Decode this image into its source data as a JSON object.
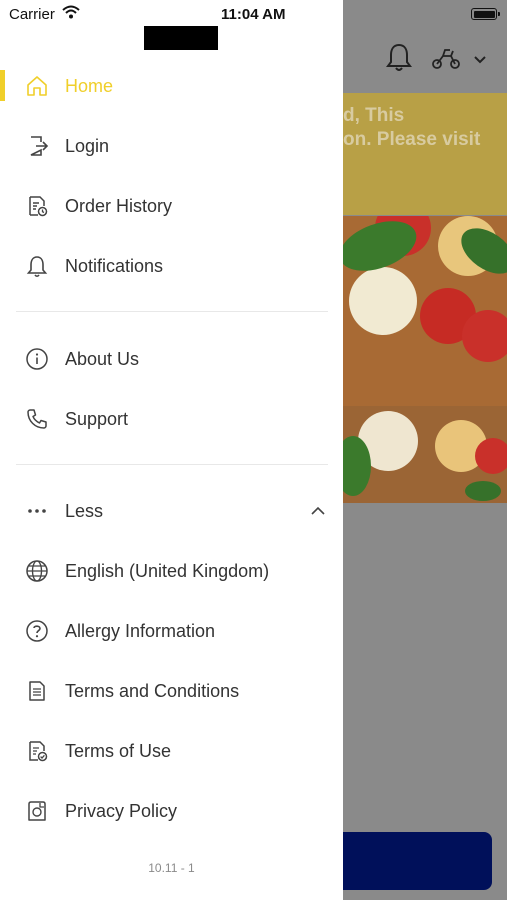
{
  "status_bar": {
    "carrier": "Carrier",
    "time": "11:04 AM"
  },
  "background": {
    "banner_text": "d, This\non. Please visit"
  },
  "menu": {
    "primary": [
      {
        "label": "Home",
        "icon": "home-icon",
        "active": true
      },
      {
        "label": "Login",
        "icon": "login-icon"
      },
      {
        "label": "Order History",
        "icon": "order-history-icon"
      },
      {
        "label": "Notifications",
        "icon": "bell-icon"
      }
    ],
    "secondary": [
      {
        "label": "About Us",
        "icon": "info-icon"
      },
      {
        "label": "Support",
        "icon": "phone-icon"
      }
    ],
    "more": {
      "label": "Less",
      "icon": "ellipsis-icon"
    },
    "extra": [
      {
        "label": "English (United Kingdom)",
        "icon": "globe-icon"
      },
      {
        "label": "Allergy Information",
        "icon": "question-icon"
      },
      {
        "label": "Terms and Conditions",
        "icon": "document-icon"
      },
      {
        "label": "Terms of Use",
        "icon": "document-check-icon"
      },
      {
        "label": "Privacy Policy",
        "icon": "privacy-icon"
      }
    ]
  },
  "version": "10.11 - 1",
  "colors": {
    "accent": "#f0cf2a",
    "text": "#333333",
    "cta": "#00105a"
  }
}
